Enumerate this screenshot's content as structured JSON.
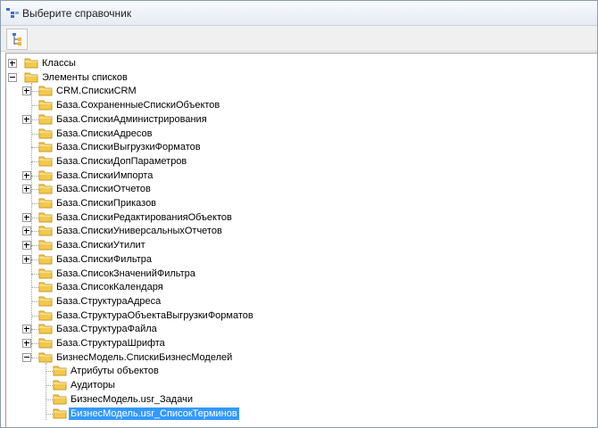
{
  "window": {
    "title": "Выберите справочник"
  },
  "toolbar": {
    "tool_icon": "tree-view-icon"
  },
  "tree": {
    "classes": "Классы",
    "list_elements": "Элементы списков",
    "children": [
      {
        "label": "CRM.СпискиCRM",
        "expandable": true
      },
      {
        "label": "База.СохраненныеСпискиОбъектов",
        "expandable": false
      },
      {
        "label": "База.СпискиАдминистрирования",
        "expandable": true
      },
      {
        "label": "База.СпискиАдресов",
        "expandable": false
      },
      {
        "label": "База.СпискиВыгрузкиФорматов",
        "expandable": false
      },
      {
        "label": "База.СпискиДопПараметров",
        "expandable": false
      },
      {
        "label": "База.СпискиИмпорта",
        "expandable": true
      },
      {
        "label": "База.СпискиОтчетов",
        "expandable": true
      },
      {
        "label": "База.СпискиПриказов",
        "expandable": false
      },
      {
        "label": "База.СпискиРедактированияОбъектов",
        "expandable": true
      },
      {
        "label": "База.СпискиУниверсальныхОтчетов",
        "expandable": true
      },
      {
        "label": "База.СпискиУтилит",
        "expandable": true
      },
      {
        "label": "База.СпискиФильтра",
        "expandable": true
      },
      {
        "label": "База.СписокЗначенийФильтра",
        "expandable": false
      },
      {
        "label": "База.СписокКалендаря",
        "expandable": false
      },
      {
        "label": "База.СтруктураАдреса",
        "expandable": false
      },
      {
        "label": "База.СтруктураОбъектаВыгрузкиФорматов",
        "expandable": false
      },
      {
        "label": "База.СтруктураФайла",
        "expandable": true
      },
      {
        "label": "База.СтруктураШрифта",
        "expandable": true
      },
      {
        "label": "БизнесМодель.СпискиБизнесМоделей",
        "expandable": true,
        "expanded": true
      }
    ],
    "business_children": [
      {
        "label": "Атрибуты объектов",
        "selected": false
      },
      {
        "label": "Аудиторы",
        "selected": false
      },
      {
        "label": "БизнесМодель.usr_Задачи",
        "selected": false
      },
      {
        "label": "БизнесМодель.usr_СписокТерминов",
        "selected": true
      }
    ]
  },
  "colors": {
    "selection": "#3399ff",
    "folder": "#f2c94c"
  }
}
